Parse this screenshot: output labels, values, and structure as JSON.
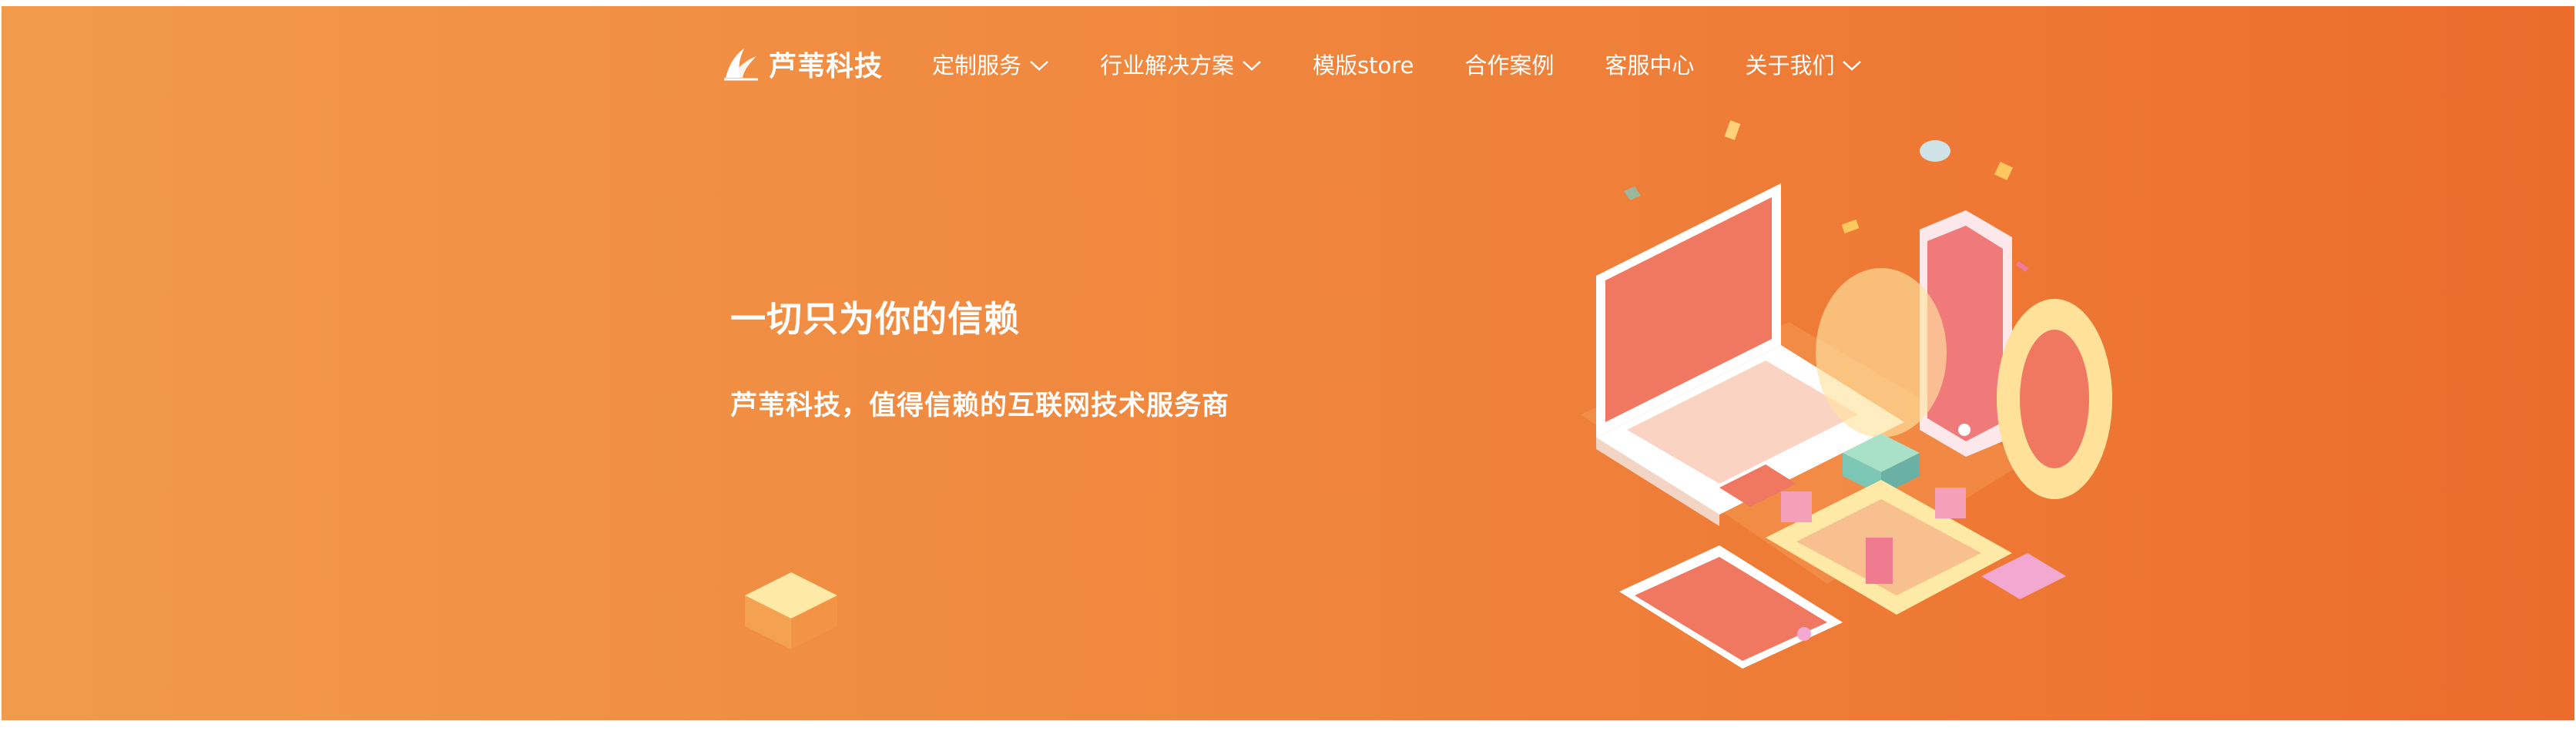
{
  "brand": {
    "name": "芦苇科技"
  },
  "nav": {
    "items": [
      {
        "label": "定制服务",
        "has_dropdown": true
      },
      {
        "label": "行业解决方案",
        "has_dropdown": true
      },
      {
        "label": "模版store",
        "has_dropdown": false
      },
      {
        "label": "合作案例",
        "has_dropdown": false
      },
      {
        "label": "客服中心",
        "has_dropdown": false
      },
      {
        "label": "关于我们",
        "has_dropdown": true
      }
    ]
  },
  "hero": {
    "headline": "一切只为你的信赖",
    "subline": "芦苇科技，值得信赖的互联网技术服务商"
  },
  "colors": {
    "gradient_start": "#F29A4C",
    "gradient_end": "#EC6C2E",
    "text": "#FFFFFF"
  },
  "icons": {
    "logo": "reed-leaf-logo",
    "dropdown": "chevron-down-icon"
  }
}
